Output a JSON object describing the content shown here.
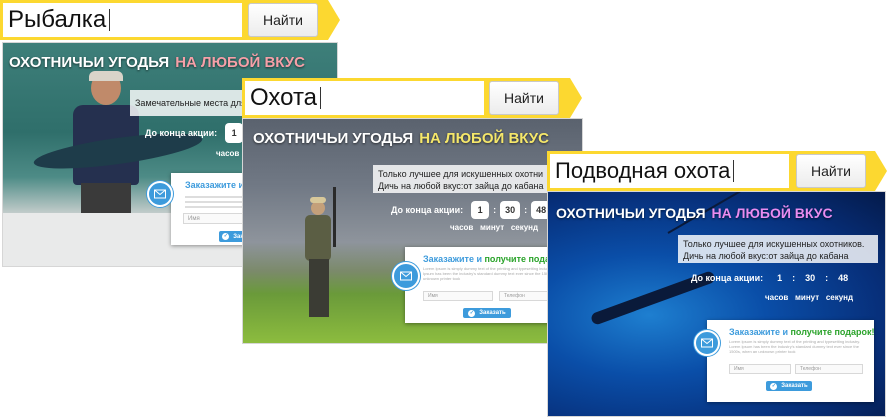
{
  "colors": {
    "search_frame": "#fcd830",
    "accent_blue": "#3d9bdc",
    "accent_green": "#2aa32a"
  },
  "search_fishing": {
    "query": "Рыбалка",
    "button": "Найти"
  },
  "search_hunting": {
    "query": "Охота",
    "button": "Найти"
  },
  "search_diving": {
    "query": "Подводная охота",
    "button": "Найти"
  },
  "card_fishing": {
    "headline_main": "ОХОТНИЧЬИ УГОДЬЯ",
    "headline_accent": "НА ЛЮБОЙ ВКУС",
    "accent_color": "#f6a0a8",
    "info_line1": "Замечательные места для",
    "timer_label": "До конца акции:",
    "timer_value": "1",
    "units": "часов",
    "form_title_part1": "Заказажите и",
    "form_title_part2": "п",
    "input_name": "Имя",
    "submit": "Заказать"
  },
  "card_hunting": {
    "headline_main": "ОХОТНИЧЬИ УГОДЬЯ",
    "headline_accent": "НА ЛЮБОЙ ВКУС",
    "accent_color": "#f5e76a",
    "info_line1": "Только лучшее для искушенных охотни",
    "info_line2": "Дичь на любой вкус:от зайца до кабана",
    "timer_label": "До конца акции:",
    "hours": "1",
    "minutes": "30",
    "seconds": "48",
    "units": "часов   минут   секунд",
    "form_title_part1": "Заказажите и",
    "form_title_part2": "получите подарок!",
    "lorem": "Lorem Ipsum is simply dummy text of the printing and typesetting industry. Lorem Ipsum has been the industry's standard dummy text ever since the 1500s, when an unknown printer took",
    "input_name": "Имя",
    "input_phone": "Телефон",
    "submit": "Заказать"
  },
  "card_diving": {
    "headline_main": "ОХОТНИЧЬИ УГОДЬЯ",
    "headline_accent": "НА ЛЮБОЙ ВКУС",
    "accent_color": "#e98cf0",
    "info_line1": "Только лучшее для искушенных охотников.",
    "info_line2": "Дичь на любой вкус:от зайца до кабана",
    "timer_label": "До конца акции:",
    "hours": "1",
    "minutes": "30",
    "seconds": "48",
    "units": "часов   минут   секунд",
    "form_title_part1": "Заказажите и",
    "form_title_part2": "получите подарок!",
    "lorem": "Lorem Ipsum is simply dummy text of the printing and typesetting industry. Lorem Ipsum has been the industry's standard dummy text ever since the 1500s, when an unknown printer took",
    "input_name": "Имя",
    "input_phone": "Телефон",
    "submit": "Заказать"
  }
}
